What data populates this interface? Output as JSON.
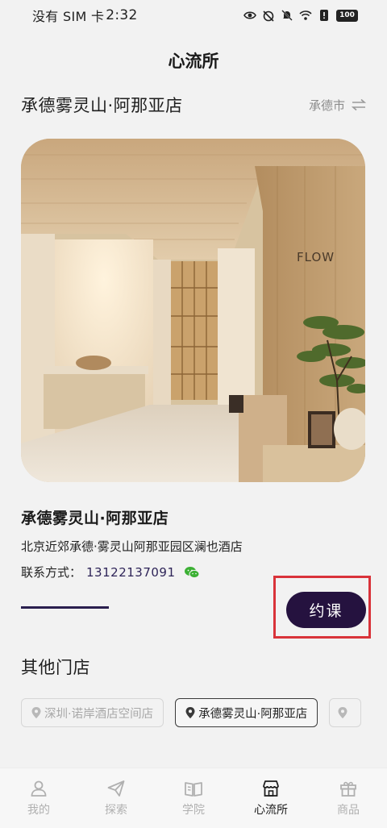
{
  "status_bar": {
    "carrier": "没有 SIM 卡",
    "time": "2:32",
    "battery": "100"
  },
  "header": {
    "title": "心流所"
  },
  "store_header": {
    "name": "承德雾灵山·阿那亚店",
    "city": "承德市"
  },
  "hero": {
    "sign_text": "FLOW"
  },
  "store": {
    "name": "承德雾灵山·阿那亚店",
    "address": "北京近郊承德·雾灵山阿那亚园区澜也酒店",
    "contact_label": "联系方式：",
    "contact_phone": "13122137091"
  },
  "actions": {
    "book_label": "约课"
  },
  "other_stores": {
    "title": "其他门店",
    "chips": [
      {
        "label": "深圳·诺岸酒店空间店",
        "state": "muted"
      },
      {
        "label": "承德雾灵山·阿那亚店",
        "state": "active"
      }
    ]
  },
  "bottom_nav": {
    "items": [
      {
        "label": "我的",
        "icon": "user-icon"
      },
      {
        "label": "探索",
        "icon": "paper-plane-icon"
      },
      {
        "label": "学院",
        "icon": "book-icon"
      },
      {
        "label": "心流所",
        "icon": "storefront-icon",
        "active": true
      },
      {
        "label": "商品",
        "icon": "gift-icon"
      }
    ]
  },
  "colors": {
    "accent": "#25123f",
    "highlight_border": "#d9333a",
    "background": "#f2f2f2"
  }
}
